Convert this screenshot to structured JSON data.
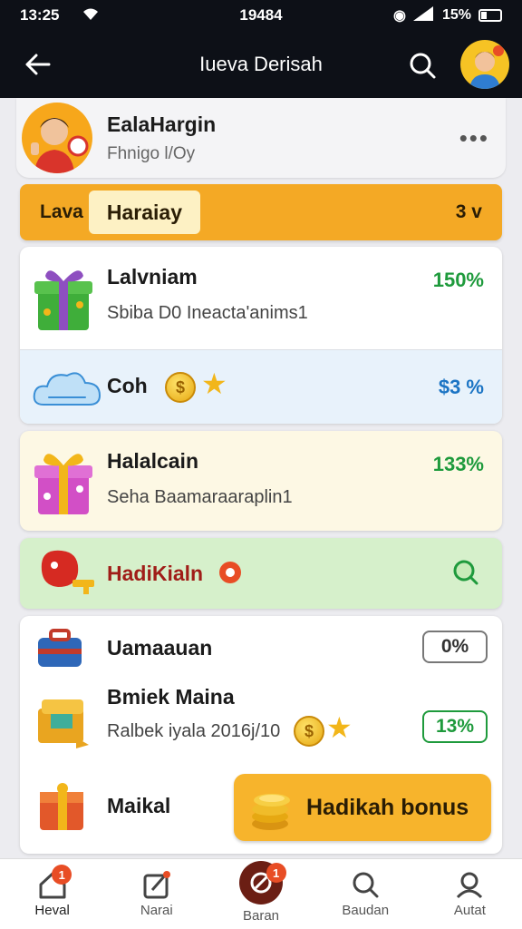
{
  "status_bar": {
    "time": "13:25",
    "center": "19484",
    "battery": "15%"
  },
  "app_bar": {
    "title": "Iueva Derisah"
  },
  "profile": {
    "name": "EalaHargin",
    "subtitle": "Fhnigo l/Oy",
    "more": "•••"
  },
  "level": {
    "label": "Lava",
    "chip": "Haraiay",
    "count": "3 v"
  },
  "card_one": {
    "rows": [
      {
        "title": "Lalvniam",
        "subtitle": "Sbiba D0 Ineacta'anims1",
        "percent": "150%"
      },
      {
        "title": "Coh",
        "coin": "$",
        "percent": "$3 %"
      }
    ]
  },
  "card_two": {
    "title": "Halalcain",
    "subtitle": "Seha Baamaraaraplin1",
    "percent": "133%"
  },
  "card_three": {
    "title": "HadiKialn"
  },
  "card_four": {
    "rows": [
      {
        "title": "Uamaauan",
        "pill": "0%"
      },
      {
        "title": "Bmiek Maina",
        "subtitle": "Ralbek iyala 2016j/10",
        "coin": "$",
        "pill": "13%"
      },
      {
        "title": "Maikal"
      }
    ],
    "bonus_button": "Hadikah bonus"
  },
  "bottom_nav": {
    "items": [
      {
        "label": "Heval",
        "badge": "1"
      },
      {
        "label": "Narai"
      },
      {
        "label": "Baran",
        "badge": "1"
      },
      {
        "label": "Baudan"
      },
      {
        "label": "Autat"
      }
    ]
  },
  "colors": {
    "dark_bar": "#0d1017",
    "accent_orange": "#f4a925",
    "green_pct": "#1e9a3c",
    "blue_pct": "#1b74c4",
    "card_blue": "#e8f2fb",
    "card_cream": "#fdf8e4",
    "card_green": "#d6f0cb",
    "badge_red": "#e84d25"
  }
}
